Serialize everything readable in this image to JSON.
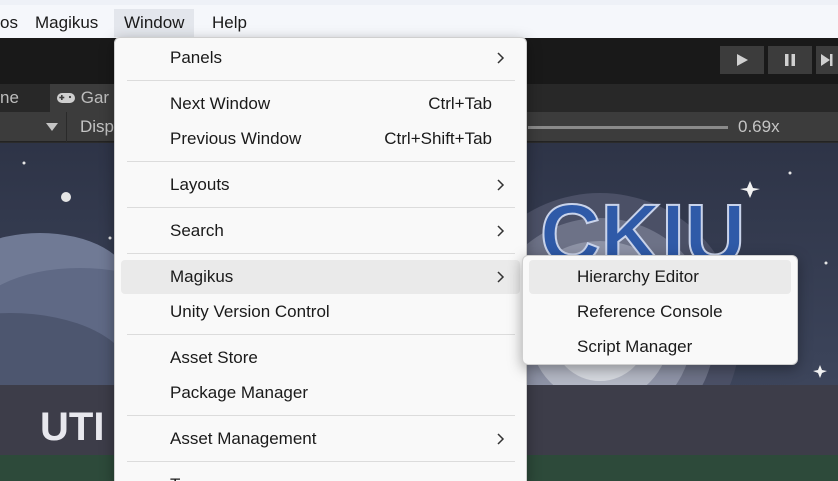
{
  "menubar": {
    "items": [
      "os",
      "Magikus",
      "Window",
      "Help"
    ]
  },
  "editor": {
    "tab_partial": "ne",
    "tab_game": "Gar",
    "display_label": "Disp",
    "zoom_value": "0.69x",
    "game_title_fragment": "CKIU",
    "game_subtitle_fragment": "UTI"
  },
  "window_menu": {
    "items": [
      {
        "label": "Panels",
        "shortcut": "",
        "submenu": true
      },
      {
        "label": "Next Window",
        "shortcut": "Ctrl+Tab",
        "submenu": false
      },
      {
        "label": "Previous Window",
        "shortcut": "Ctrl+Shift+Tab",
        "submenu": false
      },
      {
        "label": "Layouts",
        "shortcut": "",
        "submenu": true
      },
      {
        "label": "Search",
        "shortcut": "",
        "submenu": true
      },
      {
        "label": "Magikus",
        "shortcut": "",
        "submenu": true
      },
      {
        "label": "Unity Version Control",
        "shortcut": "",
        "submenu": false
      },
      {
        "label": "Asset Store",
        "shortcut": "",
        "submenu": false
      },
      {
        "label": "Package Manager",
        "shortcut": "",
        "submenu": false
      },
      {
        "label": "Asset Management",
        "shortcut": "",
        "submenu": true
      },
      {
        "label": "Te",
        "shortcut": "",
        "submenu": false
      }
    ]
  },
  "magikus_submenu": {
    "items": [
      "Hierarchy Editor",
      "Reference Console",
      "Script Manager"
    ]
  },
  "colors": {
    "menu_bg": "#f9f9f9",
    "highlight": "#eaeaea",
    "editor_dark": "#191919",
    "game_logo_blue": "#2f5aa8"
  },
  "icons": {
    "play": "play-icon",
    "pause": "pause-icon",
    "step": "step-icon",
    "submenu_arrow": "chevron-right-icon",
    "dropdown": "caret-down-icon",
    "gamepad": "gamepad-icon"
  }
}
